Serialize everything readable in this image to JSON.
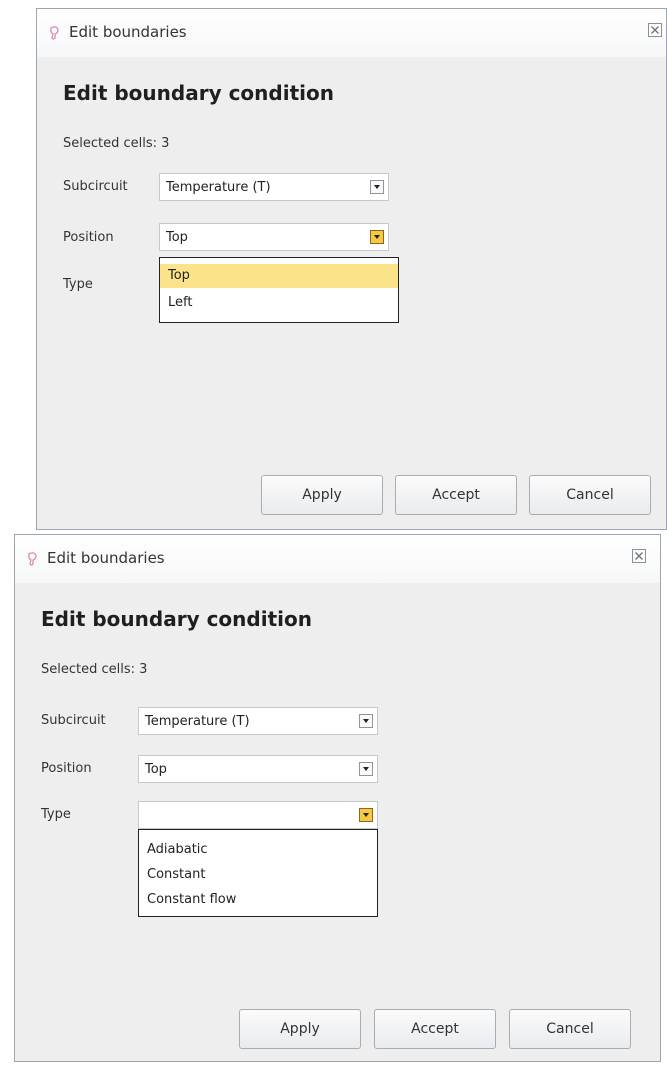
{
  "dialogs": [
    {
      "window_title": "Edit boundaries",
      "heading": "Edit boundary condition",
      "selected_cells": "Selected cells: 3",
      "fields": {
        "subcircuit": {
          "label": "Subcircuit",
          "value": "Temperature (T)"
        },
        "position": {
          "label": "Position",
          "value": "Top"
        },
        "type": {
          "label": "Type",
          "value": ""
        }
      },
      "open_dropdown": {
        "field": "position",
        "options": [
          "Top",
          "Left"
        ],
        "highlighted": "Top"
      },
      "buttons": {
        "apply": "Apply",
        "accept": "Accept",
        "cancel": "Cancel"
      }
    },
    {
      "window_title": "Edit boundaries",
      "heading": "Edit boundary condition",
      "selected_cells": "Selected cells: 3",
      "fields": {
        "subcircuit": {
          "label": "Subcircuit",
          "value": "Temperature (T)"
        },
        "position": {
          "label": "Position",
          "value": "Top"
        },
        "type": {
          "label": "Type",
          "value": ""
        }
      },
      "open_dropdown": {
        "field": "type",
        "options": [
          "Adiabatic",
          "Constant",
          "Constant flow"
        ],
        "highlighted": ""
      },
      "buttons": {
        "apply": "Apply",
        "accept": "Accept",
        "cancel": "Cancel"
      }
    }
  ],
  "icons": {
    "app": "app-window-icon",
    "close": "close-icon",
    "dropdown": "chevron-down-icon"
  },
  "colors": {
    "dialog_background": "#eeeeee",
    "titlebar_background": "#ffffff",
    "active_arrow": "#f5c944",
    "highlighted_item": "#fbe38a",
    "border": "#9aa6b2"
  }
}
